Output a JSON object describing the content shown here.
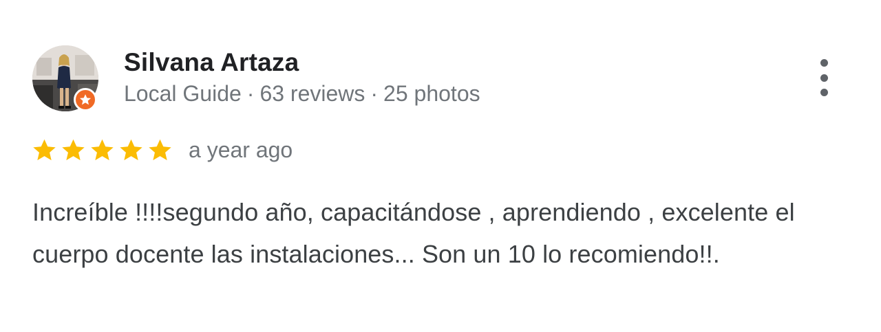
{
  "reviewer": {
    "name": "Silvana Artaza",
    "badge": "Local Guide",
    "separator": "·",
    "reviews": "63 reviews",
    "photos": "25 photos"
  },
  "rating": {
    "stars": 5,
    "max_stars": 5,
    "star_color": "#fbbc04",
    "timestamp": "a year ago"
  },
  "review": {
    "text": "Increíble !!!!segundo año, capacitándose , aprendiendo , excelente el cuerpo docente las instalaciones... Son un 10 lo recomiendo!!."
  },
  "icons": {
    "more": "more-vert-icon",
    "star": "star-icon",
    "local_guide": "local-guide-star-icon"
  },
  "colors": {
    "name": "#202124",
    "meta": "#70757a",
    "body": "#3c4043",
    "badge": "#f06a25",
    "menu_dots": "#5f6368"
  }
}
